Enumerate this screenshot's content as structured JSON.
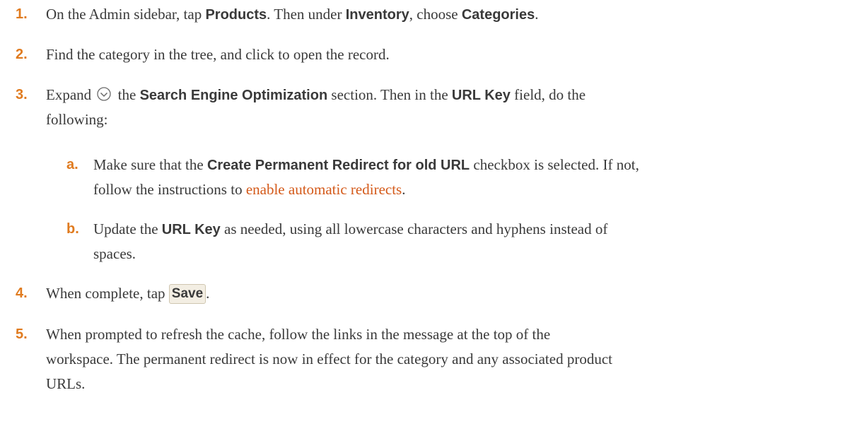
{
  "steps": [
    {
      "num": "1.",
      "t1": "On the Admin sidebar, tap ",
      "b1": "Products",
      "t2": ". Then under ",
      "b2": "Inventory",
      "t3": ", choose ",
      "b3": "Categories",
      "t4": "."
    },
    {
      "num": "2.",
      "t1": "Find the category in the tree, and click to open the record."
    },
    {
      "num": "3.",
      "t1": "Expand ",
      "icon": "chevron-circle-down-icon",
      "t2": " the ",
      "b1": "Search Engine Optimization",
      "t3": " section. Then in the ",
      "b2": "URL Key",
      "t4": " field, do the",
      "line2": "following:"
    },
    {
      "num": "4.",
      "t1": "When complete, tap ",
      "button": "Save",
      "t2": "."
    },
    {
      "num": "5.",
      "line1": "When prompted to refresh the cache, follow the links in the message at the top of the",
      "line2": "workspace. The permanent redirect is now in effect for the category and any associated product",
      "line3": "URLs."
    }
  ],
  "substeps": [
    {
      "num": "a.",
      "t1": "Make sure that the ",
      "b1": "Create Permanent Redirect for old URL",
      "t2": " checkbox is selected. If not,",
      "line2a": "follow the instructions to ",
      "link": "enable automatic redirects",
      "line2b": "."
    },
    {
      "num": "b.",
      "t1": "Update the ",
      "b1": "URL Key",
      "t2": " as needed, using all lowercase characters and hyphens instead of",
      "line2": "spaces."
    }
  ],
  "colors": {
    "step_number": "#e07b1f",
    "link": "#d45a1a",
    "text": "#3a3a3a"
  }
}
